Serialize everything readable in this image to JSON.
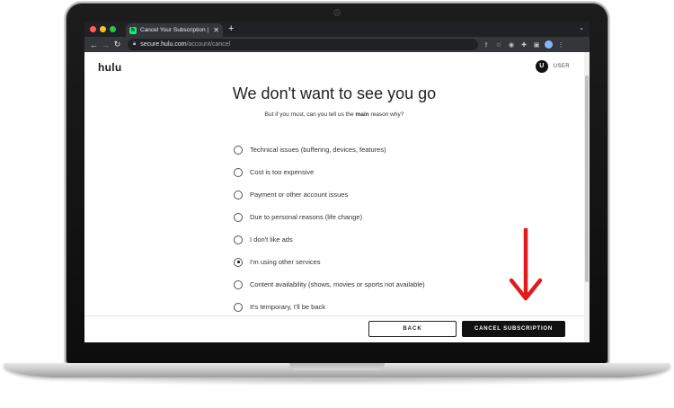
{
  "browser": {
    "tab_title": "Cancel Your Subscription | Hul",
    "tab_favicon": "h",
    "close_symbol": "✕",
    "new_tab_symbol": "+",
    "url_host": "secure.hulu.com",
    "url_path": "/account/cancel"
  },
  "header": {
    "logo": "hulu",
    "avatar_initial": "U",
    "user_label": "USER"
  },
  "main": {
    "heading": "We don't want to see you go",
    "subheading_pre": "But if you must, can you tell us the ",
    "subheading_bold": "main",
    "subheading_post": " reason why?",
    "options": [
      {
        "label": "Technical issues (buffering, devices, features)",
        "checked": false
      },
      {
        "label": "Cost is too expensive",
        "checked": false
      },
      {
        "label": "Payment or other account issues",
        "checked": false
      },
      {
        "label": "Due to personal reasons (life change)",
        "checked": false
      },
      {
        "label": "I don't like ads",
        "checked": false
      },
      {
        "label": "I'm using other services",
        "checked": true
      },
      {
        "label": "Content availability (shows, movies or sports not available)",
        "checked": false
      },
      {
        "label": "It's temporary, I'll be back",
        "checked": false
      }
    ]
  },
  "footer": {
    "back_label": "BACK",
    "cancel_label": "CANCEL SUBSCRIPTION"
  },
  "annotation": {
    "arrow_color": "#e01b1b"
  }
}
